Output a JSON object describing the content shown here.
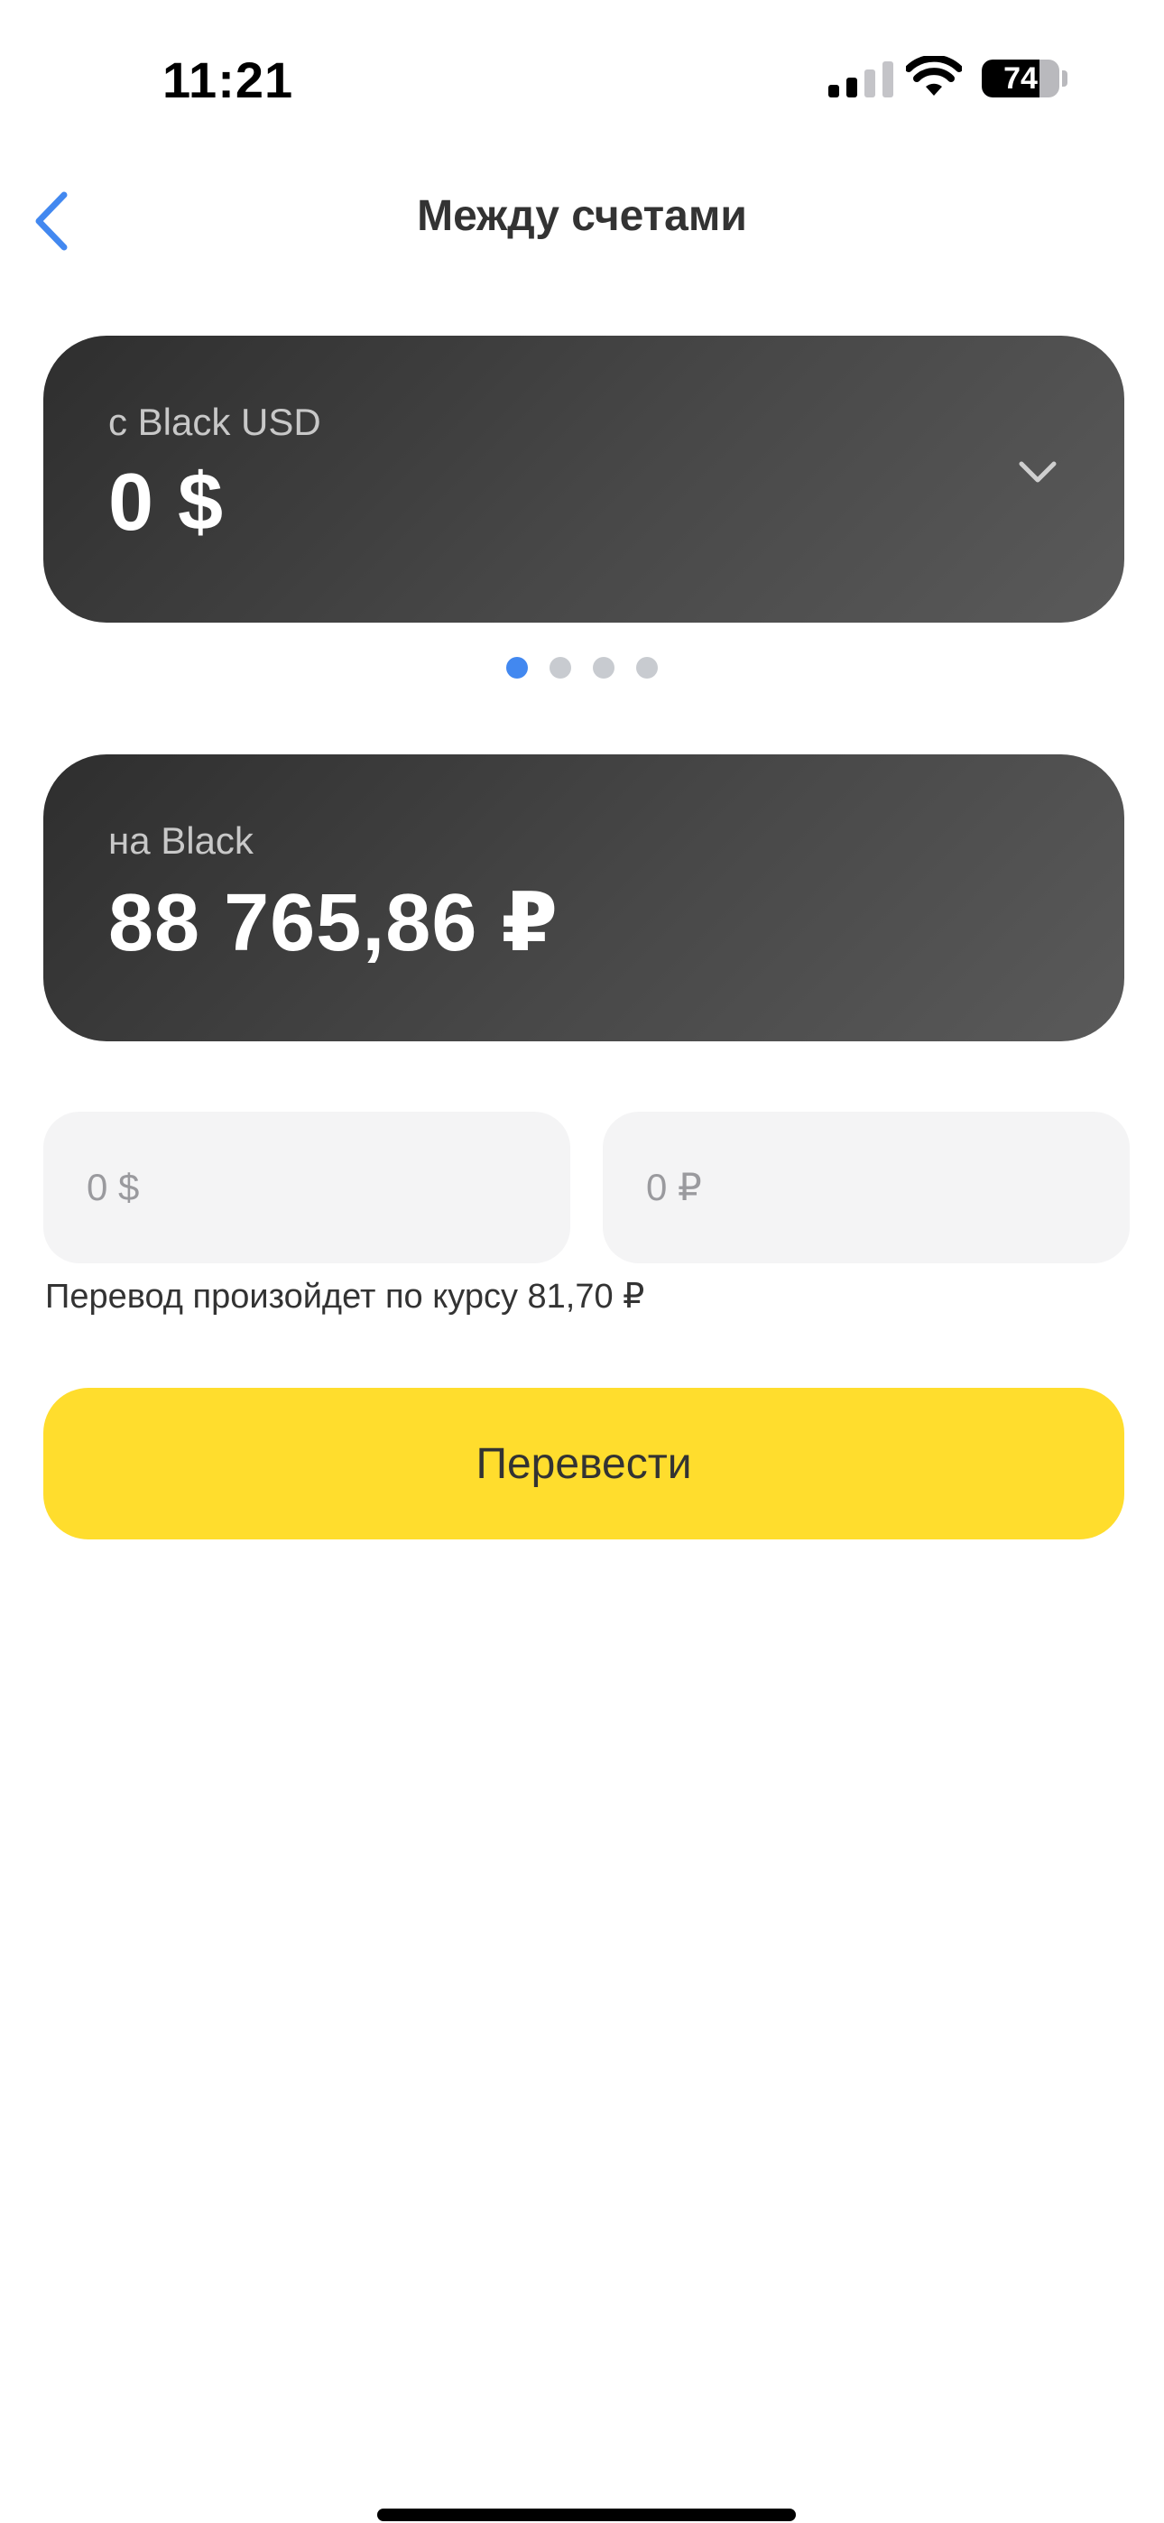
{
  "status_bar": {
    "time": "11:21",
    "battery_percent": "74",
    "battery_level": 0.74,
    "signal_bars_active": 2,
    "signal_bars_total": 4
  },
  "nav": {
    "title": "Между счетами",
    "back_icon": "chevron-left-icon"
  },
  "from_account": {
    "label": "с Black USD",
    "amount": "0 $",
    "dropdown_icon": "chevron-down-icon"
  },
  "pager": {
    "count": 4,
    "active_index": 0
  },
  "to_account": {
    "label": "на Black",
    "amount": "88 765,86 ₽"
  },
  "inputs": {
    "usd_placeholder": "0 $",
    "rub_placeholder": "0 ₽"
  },
  "rate_note": "Перевод произойдет по курсу 81,70 ₽",
  "transfer_button_label": "Перевести",
  "colors": {
    "accent_blue": "#4288f0",
    "button_yellow": "#ffdd2d",
    "card_dark": "#3c3c3c"
  }
}
